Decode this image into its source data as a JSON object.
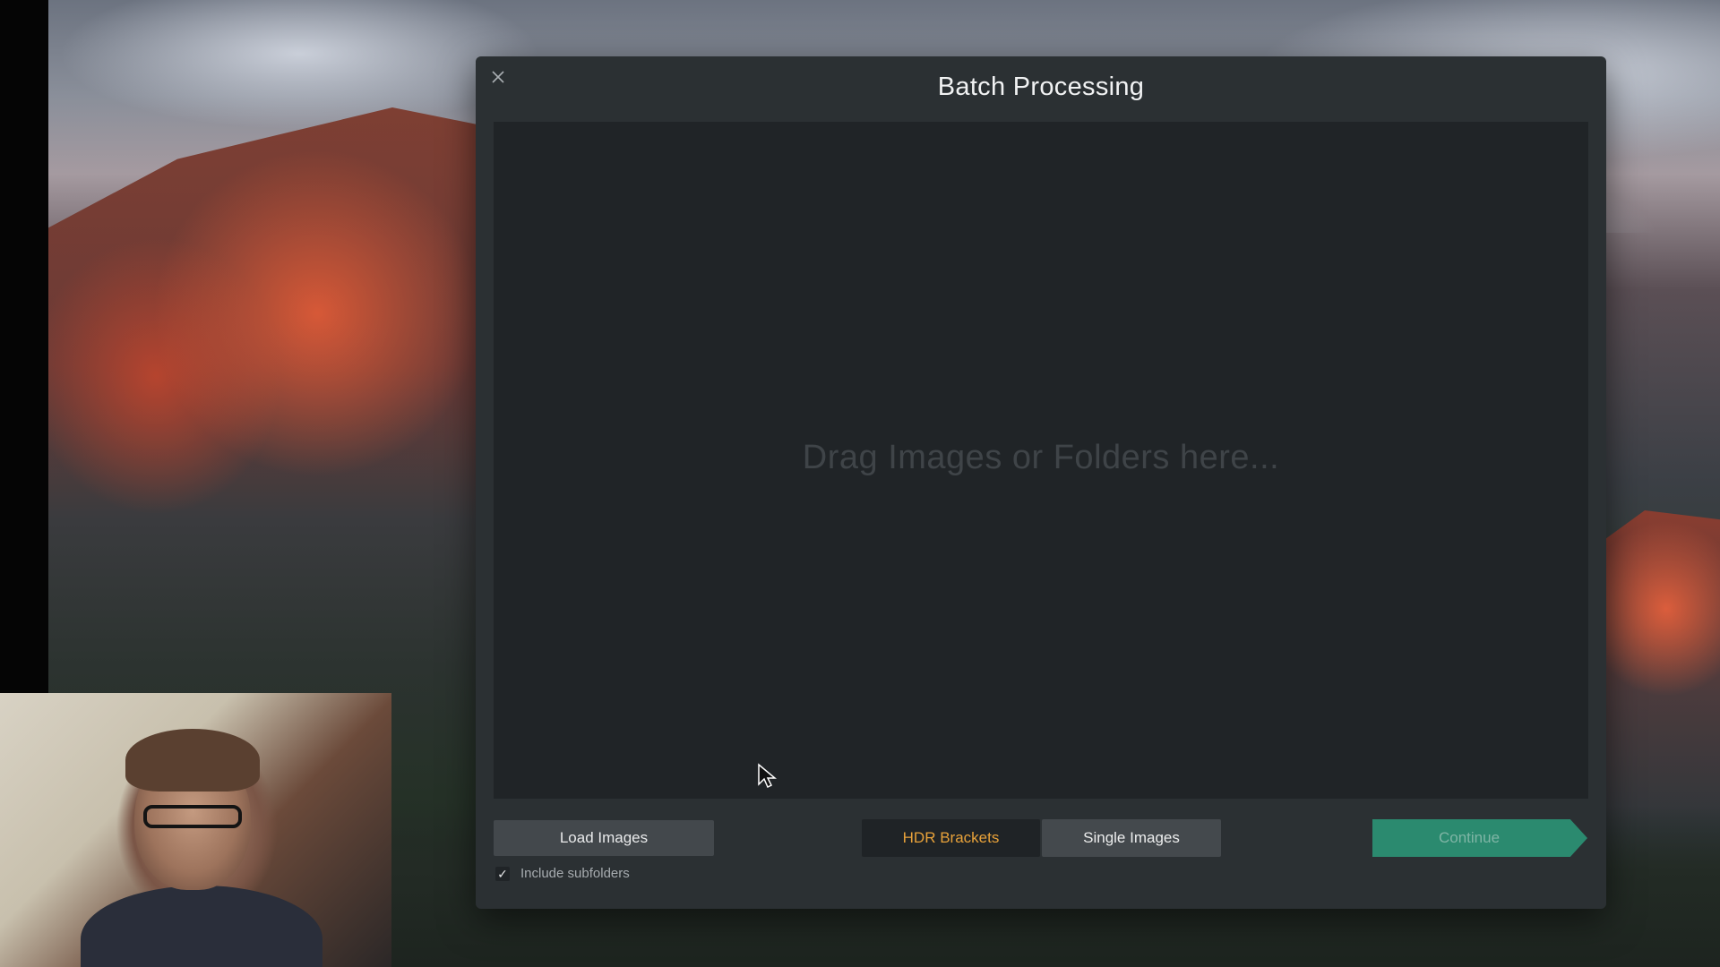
{
  "dialog": {
    "title": "Batch Processing",
    "close_icon": "close-icon",
    "drop_hint": "Drag Images or Folders here...",
    "load_button": "Load Images",
    "mode_segments": [
      {
        "label": "HDR Brackets",
        "selected": true
      },
      {
        "label": "Single Images",
        "selected": false
      }
    ],
    "continue_button": "Continue",
    "include_subfolders_label": "Include subfolders",
    "include_subfolders_checked": true
  },
  "colors": {
    "dialog_bg": "#2b3033",
    "drop_zone_bg": "#202427",
    "selected_segment_text": "#e8a23a",
    "continue_bg": "#2b8a6f"
  }
}
